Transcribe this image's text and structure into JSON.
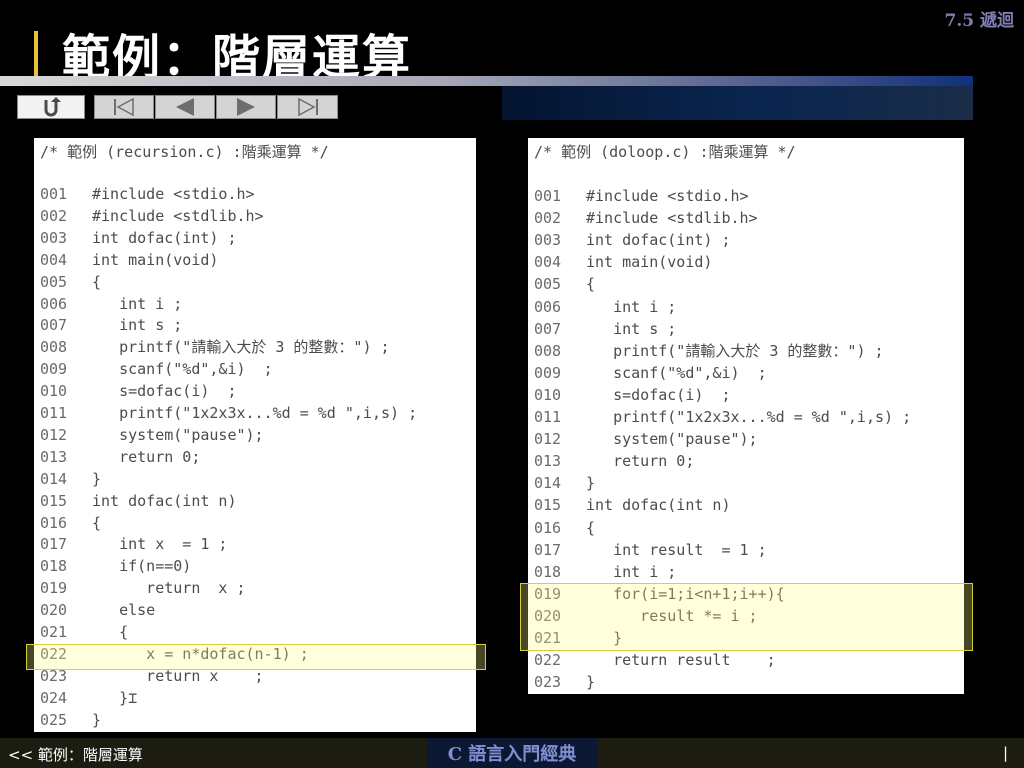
{
  "section_tag": "7.5 遞迴",
  "title": "範例：階層運算",
  "nav": {
    "back_icon": "return-arrow",
    "first_glyph": "⏮",
    "prev_glyph": "◀",
    "next_glyph": "▶",
    "last_glyph": "⏭"
  },
  "left_panel": {
    "header": "/* 範例 (recursion.c) :階乘運算 */",
    "lines": [
      {
        "num": "001",
        "code": "#include <stdio.h>"
      },
      {
        "num": "002",
        "code": "#include <stdlib.h>"
      },
      {
        "num": "003",
        "code": "int dofac(int) ;"
      },
      {
        "num": "004",
        "code": "int main(void)"
      },
      {
        "num": "005",
        "code": "{"
      },
      {
        "num": "006",
        "code": "   int i ;"
      },
      {
        "num": "007",
        "code": "   int s ;"
      },
      {
        "num": "008",
        "code": "   printf(\"請輸入大於 3 的整數：\") ;"
      },
      {
        "num": "009",
        "code": "   scanf(\"%d\",&i)  ;"
      },
      {
        "num": "010",
        "code": "   s=dofac(i)  ;"
      },
      {
        "num": "011",
        "code": "   printf(\"1x2x3x...%d = %d \",i,s) ;"
      },
      {
        "num": "012",
        "code": "   system(\"pause\");"
      },
      {
        "num": "013",
        "code": "   return 0;"
      },
      {
        "num": "014",
        "code": "}"
      },
      {
        "num": "015",
        "code": "int dofac(int n)"
      },
      {
        "num": "016",
        "code": "{"
      },
      {
        "num": "017",
        "code": "   int x  = 1 ;"
      },
      {
        "num": "018",
        "code": "   if(n==0)"
      },
      {
        "num": "019",
        "code": "      return  x ;"
      },
      {
        "num": "020",
        "code": "   else"
      },
      {
        "num": "021",
        "code": "   {"
      },
      {
        "num": "022",
        "code": "      x = n*dofac(n-1) ;"
      },
      {
        "num": "023",
        "code": "      return x    ;"
      },
      {
        "num": "024",
        "code": "   }⌶"
      },
      {
        "num": "025",
        "code": "}"
      }
    ]
  },
  "right_panel": {
    "header": "/* 範例 (doloop.c) :階乘運算 */",
    "lines": [
      {
        "num": "001",
        "code": "#include <stdio.h>"
      },
      {
        "num": "002",
        "code": "#include <stdlib.h>"
      },
      {
        "num": "003",
        "code": "int dofac(int) ;"
      },
      {
        "num": "004",
        "code": "int main(void)"
      },
      {
        "num": "005",
        "code": "{"
      },
      {
        "num": "006",
        "code": "   int i ;"
      },
      {
        "num": "007",
        "code": "   int s ;"
      },
      {
        "num": "008",
        "code": "   printf(\"請輸入大於 3 的整數：\") ;"
      },
      {
        "num": "009",
        "code": "   scanf(\"%d\",&i)  ;"
      },
      {
        "num": "010",
        "code": "   s=dofac(i)  ;"
      },
      {
        "num": "011",
        "code": "   printf(\"1x2x3x...%d = %d \",i,s) ;"
      },
      {
        "num": "012",
        "code": "   system(\"pause\");"
      },
      {
        "num": "013",
        "code": "   return 0;"
      },
      {
        "num": "014",
        "code": "}"
      },
      {
        "num": "015",
        "code": "int dofac(int n)"
      },
      {
        "num": "016",
        "code": "{"
      },
      {
        "num": "017",
        "code": "   int result  = 1 ;"
      },
      {
        "num": "018",
        "code": "   int i ;"
      },
      {
        "num": "019",
        "code": "   for(i=1;i<n+1;i++){"
      },
      {
        "num": "020",
        "code": "      result *= i ;"
      },
      {
        "num": "021",
        "code": "   }"
      },
      {
        "num": "022",
        "code": "   return result    ;"
      },
      {
        "num": "023",
        "code": "}"
      }
    ]
  },
  "footer": {
    "left": "<< 範例：階層運算",
    "center": "C 語言入門經典",
    "right": "|"
  }
}
